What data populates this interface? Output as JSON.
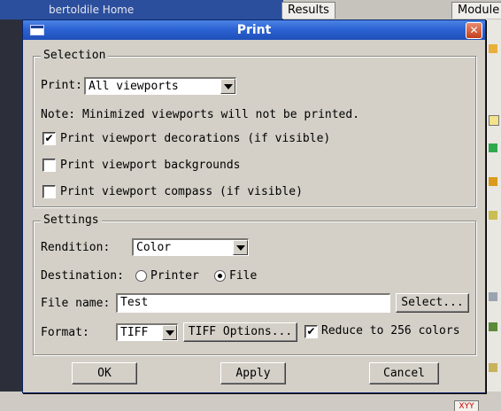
{
  "background": {
    "window_title": "bertoldile Home",
    "tabs": [
      "Results",
      "Module"
    ],
    "xy_badge": "XYY"
  },
  "dialog": {
    "title": "Print",
    "close_label": "✕",
    "selection": {
      "group_label": "Selection",
      "print_label": "Print:",
      "print_value": "All viewports",
      "note": "Note: Minimized viewports will not be printed.",
      "checkboxes": [
        {
          "label": "Print viewport decorations (if visible)",
          "checked": true
        },
        {
          "label": "Print viewport backgrounds",
          "checked": false
        },
        {
          "label": "Print viewport compass (if visible)",
          "checked": false
        }
      ]
    },
    "settings": {
      "group_label": "Settings",
      "rendition_label": "Rendition:",
      "rendition_value": "Color",
      "destination_label": "Destination:",
      "destination_options": [
        {
          "label": "Printer",
          "selected": false
        },
        {
          "label": "File",
          "selected": true
        }
      ],
      "filename_label": "File name:",
      "filename_value": "Test",
      "select_button": "Select...",
      "format_label": "Format:",
      "format_value": "TIFF",
      "tiff_options_button": "TIFF Options...",
      "reduce_colors": {
        "label": "Reduce to 256 colors",
        "checked": true
      }
    },
    "buttons": {
      "ok": "OK",
      "apply": "Apply",
      "cancel": "Cancel"
    },
    "colors": {
      "titlebar": "#2c63d3",
      "dialog_bg": "#d4d0c8"
    }
  }
}
